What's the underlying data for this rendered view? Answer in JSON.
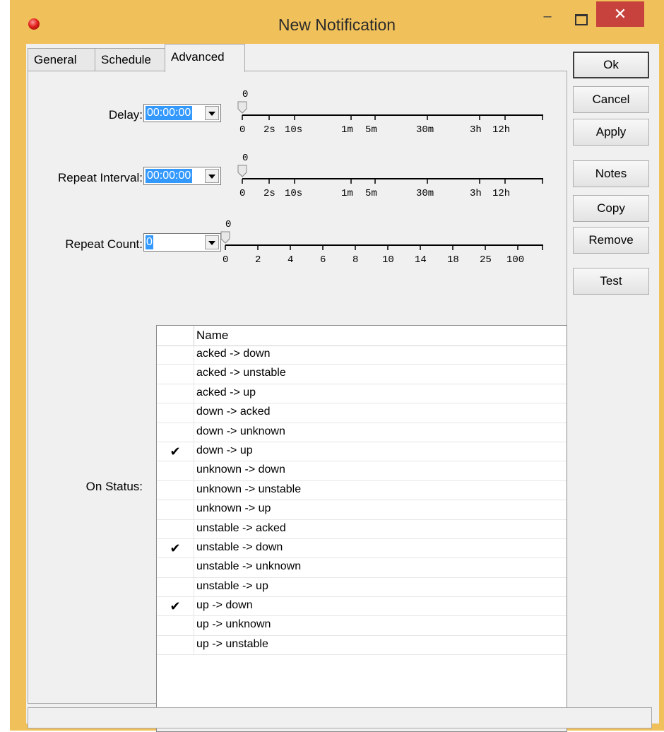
{
  "window": {
    "title": "New Notification",
    "minimize": "–",
    "close": "✕"
  },
  "tabs": [
    {
      "label": "General"
    },
    {
      "label": "Schedule"
    },
    {
      "label": "Advanced"
    }
  ],
  "buttons": {
    "ok": "Ok",
    "cancel": "Cancel",
    "apply": "Apply",
    "notes": "Notes",
    "copy": "Copy",
    "remove": "Remove",
    "test": "Test"
  },
  "delay": {
    "label": "Delay:",
    "value": "00:00:00",
    "slider_value": "0",
    "ticks": [
      "0",
      "2s",
      "10s",
      "1m",
      "5m",
      "30m",
      "3h",
      "12h"
    ]
  },
  "repeat_interval": {
    "label": "Repeat Interval:",
    "value": "00:00:00",
    "slider_value": "0",
    "ticks": [
      "0",
      "2s",
      "10s",
      "1m",
      "5m",
      "30m",
      "3h",
      "12h"
    ]
  },
  "repeat_count": {
    "label": "Repeat Count:",
    "value": "0",
    "slider_value": "0",
    "ticks": [
      "0",
      "2",
      "4",
      "6",
      "8",
      "10",
      "14",
      "18",
      "25",
      "100"
    ]
  },
  "on_status": {
    "label": "On Status:",
    "column": "Name",
    "rows": [
      {
        "checked": false,
        "name": "acked -> down"
      },
      {
        "checked": false,
        "name": "acked -> unstable"
      },
      {
        "checked": false,
        "name": "acked -> up"
      },
      {
        "checked": false,
        "name": "down -> acked"
      },
      {
        "checked": false,
        "name": "down -> unknown"
      },
      {
        "checked": true,
        "name": "down -> up"
      },
      {
        "checked": false,
        "name": "unknown -> down"
      },
      {
        "checked": false,
        "name": "unknown -> unstable"
      },
      {
        "checked": false,
        "name": "unknown -> up"
      },
      {
        "checked": false,
        "name": "unstable -> acked"
      },
      {
        "checked": true,
        "name": "unstable -> down"
      },
      {
        "checked": false,
        "name": "unstable -> unknown"
      },
      {
        "checked": false,
        "name": "unstable -> up"
      },
      {
        "checked": true,
        "name": "up -> down"
      },
      {
        "checked": false,
        "name": "up -> unknown"
      },
      {
        "checked": false,
        "name": "up -> unstable"
      }
    ],
    "check_glyph": "✔"
  },
  "colors": {
    "frame": "#f0c05a",
    "close": "#c7423d",
    "selection": "#3399ff"
  }
}
